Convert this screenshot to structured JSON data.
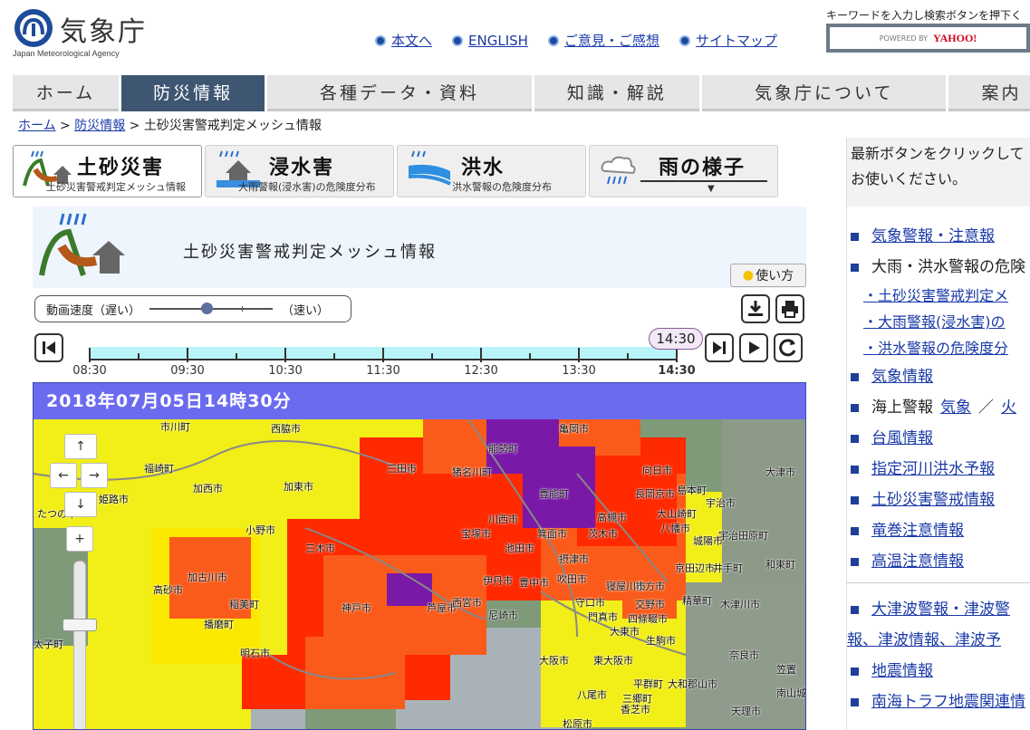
{
  "header": {
    "logo_jp": "気象庁",
    "logo_en": "Japan Meteorological Agency",
    "links": [
      "本文へ",
      "ENGLISH",
      "ご意見・ご感想",
      "サイトマップ"
    ],
    "search_hint": "キーワードを入力し検索ボタンを押下く",
    "search_powered": "POWERED BY",
    "search_brand": "YAHOO!"
  },
  "nav": [
    "ホーム",
    "防災情報",
    "各種データ・資料",
    "知識・解説",
    "気象庁について",
    "案内"
  ],
  "breadcrumb": {
    "home": "ホーム",
    "sep1": " > ",
    "disaster": "防災情報",
    "sep2": " > ",
    "current": "土砂災害警戒判定メッシュ情報"
  },
  "product_tabs": [
    {
      "title": "土砂災害",
      "sub": "土砂災害警戒判定メッシュ情報"
    },
    {
      "title": "浸水害",
      "sub": "大雨警報(浸水害)の危険度分布"
    },
    {
      "title": "洪水",
      "sub": "洪水警報の危険度分布"
    },
    {
      "title": "雨の様子",
      "sub": ""
    }
  ],
  "panel": {
    "title": "土砂災害警戒判定メッシュ情報",
    "howto": "使い方"
  },
  "speed": {
    "label": "動画速度（遅い）",
    "fast": "（速い）",
    "level": 0.46
  },
  "timeline": {
    "labels": [
      "08:30",
      "09:30",
      "10:30",
      "11:30",
      "12:30",
      "13:30",
      "14:30"
    ],
    "current": "14:30"
  },
  "map": {
    "timestamp": "2018年07月05日14時30分",
    "cities": [
      "市川町",
      "西脇市",
      "亀岡市",
      "能勢町",
      "福崎町",
      "三田市",
      "猪名川町",
      "向日市",
      "大津市",
      "加西市",
      "加東市",
      "豊能町",
      "長岡京市",
      "宇治市",
      "姫路市",
      "川西市",
      "高槻市",
      "小野市",
      "宝塚市",
      "池田市",
      "箕面市",
      "茨木市",
      "八幡市",
      "城陽市",
      "宇治田原町",
      "三木市",
      "加古川市",
      "伊丹市",
      "豊中市",
      "吹田市",
      "枚方市",
      "京田辺市",
      "井手町",
      "和束町",
      "高砂市",
      "稲美町",
      "神戸市",
      "芦屋市",
      "西宮市",
      "尼崎市",
      "守口市",
      "交野市",
      "精華町",
      "木津川市",
      "播磨町",
      "明石市",
      "門真市",
      "四條畷市",
      "大東市",
      "生駒市",
      "大阪市",
      "東大阪市",
      "奈良市",
      "平群町",
      "大和郡山市",
      "八尾市",
      "天理市",
      "松原市",
      "香芝市",
      "三郷町",
      "大山崎町",
      "島本町",
      "摂津市",
      "寝屋川市",
      "笠置",
      "南山城村",
      "たつの市",
      "太子町"
    ]
  },
  "sidebar": {
    "intro": [
      "最新ボタンをクリックして",
      "お使いください。"
    ],
    "items": [
      {
        "label": "気象警報・注意報",
        "link": true
      },
      {
        "label": "大雨・洪水警報の危険",
        "link": false
      },
      {
        "label": "・土砂災害警戒判定メ",
        "link": true,
        "sub": true
      },
      {
        "label": "・大雨警報(浸水害)の",
        "link": true,
        "sub": true
      },
      {
        "label": "・洪水警報の危険度分",
        "link": true,
        "sub": true
      },
      {
        "label": "気象情報",
        "link": true
      },
      {
        "label": "海上警報",
        "link": false,
        "extra": [
          "気象",
          "／",
          "火"
        ]
      },
      {
        "label": "台風情報",
        "link": true
      },
      {
        "label": "指定河川洪水予報",
        "link": true
      },
      {
        "label": "土砂災害警戒情報",
        "link": true
      },
      {
        "label": "竜巻注意情報",
        "link": true
      },
      {
        "label": "高温注意情報",
        "link": true
      }
    ],
    "items2": [
      {
        "label": "大津波警報・津波警",
        "link": true
      },
      {
        "label": "報、津波情報、津波予",
        "link": true,
        "cont": true
      },
      {
        "label": "地震情報",
        "link": true
      },
      {
        "label": "南海トラフ地震関連情",
        "link": true
      }
    ]
  },
  "colors": {
    "nav_active": "#3e5672",
    "map_header": "#6b6bf0",
    "level_yellow": "#f2ee17",
    "level_red": "#ff2a00",
    "level_orange": "#fa5b1a",
    "level_purple": "#7a18a8"
  }
}
